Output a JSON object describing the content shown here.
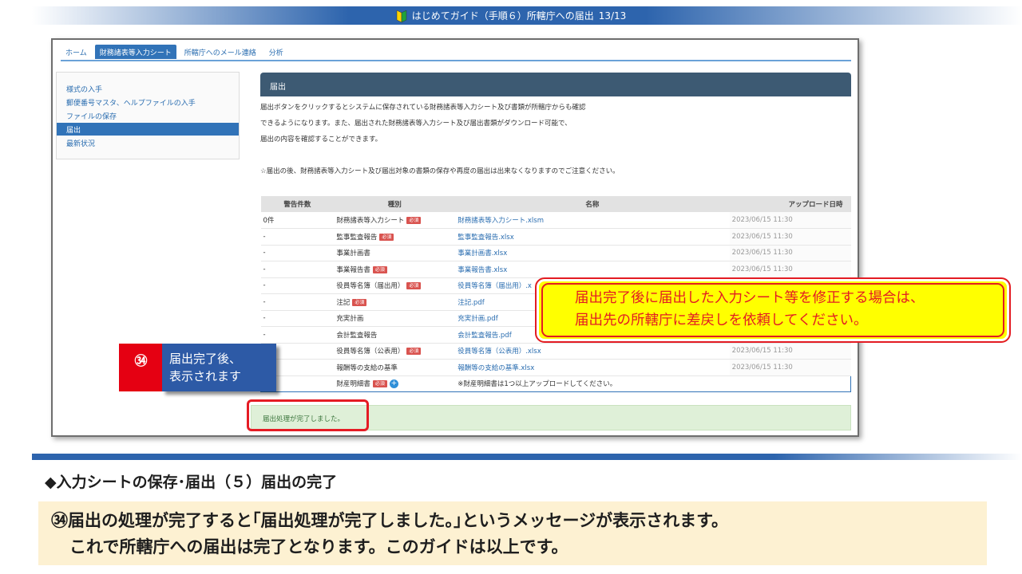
{
  "banner": {
    "title": "はじめてガイド（手順６）所轄庁への届出",
    "page": "13/13"
  },
  "tabs": [
    "ホーム",
    "財務諸表等入力シート",
    "所轄庁へのメール連絡",
    "分析"
  ],
  "sidebar": [
    "様式の入手",
    "郵便番号マスタ、ヘルプファイルの入手",
    "ファイルの保存",
    "届出",
    "最新状況"
  ],
  "panel": {
    "title": "届出",
    "para1": "届出ボタンをクリックするとシステムに保存されている財務諸表等入力シート及び書類が所轄庁からも確認",
    "para2": "できるようになります。また、届出された財務諸表等入力シート及び届出書類がダウンロード可能で、",
    "para3": "届出の内容を確認することができます。",
    "note": "☆届出の後、財務諸表等入力シート及び届出対象の書類の保存や再度の届出は出来なくなりますのでご注意ください。"
  },
  "table": {
    "headers": [
      "警告件数",
      "種別",
      "名称",
      "アップロード日時"
    ],
    "required_label": "必須",
    "rows": [
      {
        "count": "0件",
        "type": "財務諸表等入力シート",
        "req": true,
        "name": "財務諸表等入力シート.xlsm",
        "date": "2023/06/15 11:30"
      },
      {
        "count": "-",
        "type": "監事監査報告",
        "req": true,
        "name": "監事監査報告.xlsx",
        "date": "2023/06/15 11:30"
      },
      {
        "count": "-",
        "type": "事業計画書",
        "req": false,
        "name": "事業計画書.xlsx",
        "date": "2023/06/15 11:30"
      },
      {
        "count": "-",
        "type": "事業報告書",
        "req": true,
        "name": "事業報告書.xlsx",
        "date": "2023/06/15 11:30"
      },
      {
        "count": "-",
        "type": "役員等名簿（届出用）",
        "req": true,
        "name": "役員等名簿（届出用）.x",
        "date": ""
      },
      {
        "count": "-",
        "type": "注記",
        "req": true,
        "name": "注記.pdf",
        "date": ""
      },
      {
        "count": "-",
        "type": "充実計画",
        "req": false,
        "name": "充実計画.pdf",
        "date": ""
      },
      {
        "count": "-",
        "type": "会計監査報告",
        "req": false,
        "name": "会計監査報告.pdf",
        "date": ""
      },
      {
        "count": "",
        "type": "役員等名簿（公表用）",
        "req": true,
        "name": "役員等名簿（公表用）.xlsx",
        "date": "2023/06/15 11:30"
      },
      {
        "count": "",
        "type": "報酬等の支給の基準",
        "req": false,
        "name": "報酬等の支給の基準.xlsx",
        "date": "2023/06/15 11:30"
      }
    ],
    "last_row": {
      "type": "財産明細書",
      "name": "※財産明細書は1つ以上アップロードしてください。"
    }
  },
  "done_message": "届出処理が完了しました。",
  "step": {
    "number": "㉞",
    "line1": "届出完了後、",
    "line2": "表示されます"
  },
  "callout": {
    "line1": "届出完了後に届出した入力シート等を修正する場合は、",
    "line2": "届出先の所轄庁に差戻しを依頼してください。"
  },
  "section_title": "◆入力シートの保存･届出（５）届出の完了",
  "explanation": {
    "line1": "㉞届出の処理が完了すると｢届出処理が完了しました。｣というメッセージが表示されます。",
    "line2": "これで所轄庁への届出は完了となります。このガイドは以上です。"
  },
  "colors": {
    "accent": "#2d64ad",
    "alert": "#e31b23",
    "callout_bg": "#ffff00"
  }
}
